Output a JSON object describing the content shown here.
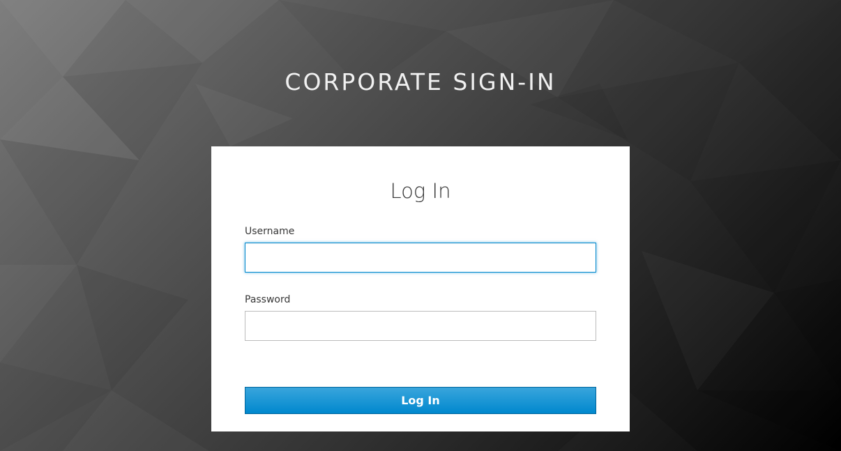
{
  "header": {
    "title": "CORPORATE SIGN-IN"
  },
  "login_form": {
    "title": "Log In",
    "username": {
      "label": "Username",
      "value": "",
      "placeholder": ""
    },
    "password": {
      "label": "Password",
      "value": "",
      "placeholder": ""
    },
    "submit_label": "Log In"
  },
  "colors": {
    "accent": "#0088ce",
    "button_top": "#39a5dc",
    "button_border": "#00659c",
    "card_background": "#ffffff",
    "background_dark": "#000000",
    "background_light": "#7a7a7a"
  }
}
